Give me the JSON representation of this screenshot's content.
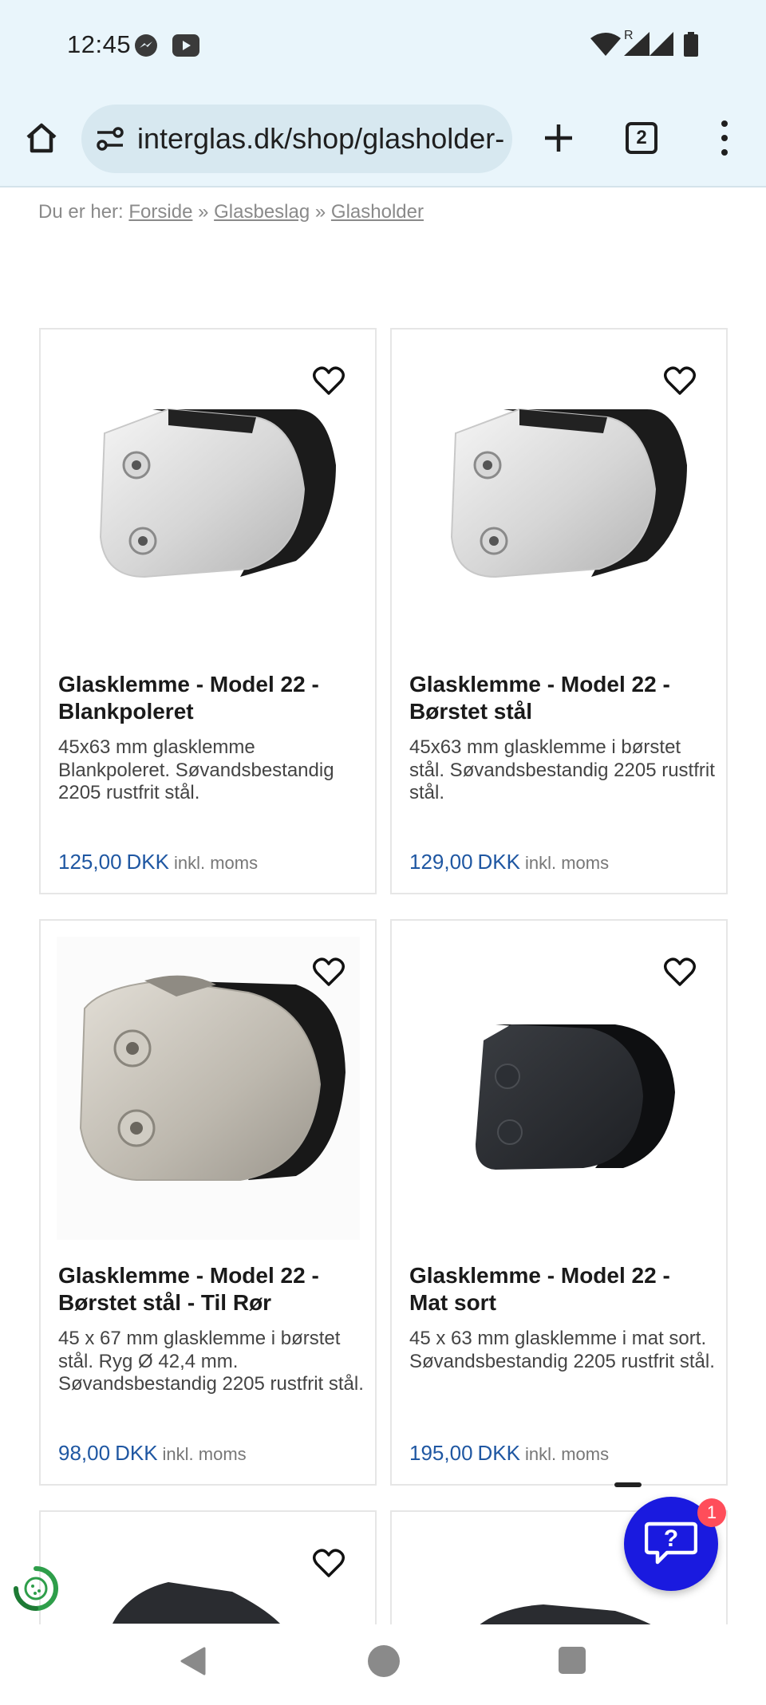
{
  "status_bar": {
    "time": "12:45",
    "icons": [
      "messenger-icon",
      "youtube-icon",
      "wifi-icon",
      "signal-icon",
      "signal-icon",
      "battery-icon"
    ],
    "roaming_label": "R"
  },
  "browser": {
    "url": "interglas.dk/shop/glasholder-",
    "tab_count": "2",
    "icons": [
      "home-icon",
      "site-settings-icon",
      "plus-icon",
      "tab-switcher-icon",
      "menu-icon"
    ]
  },
  "breadcrumb": {
    "prefix": "Du er her:",
    "items": [
      "Forside",
      "Glasbeslag",
      "Glasholder"
    ],
    "separator": "»"
  },
  "products": [
    {
      "title": "Glasklemme - Model 22 - Blankpoleret",
      "description": "45x63 mm glasklemme Blankpoleret. Søvandsbestandig 2205 rustfrit stål.",
      "price": "125,00",
      "currency": "DKK",
      "vat_note": "inkl. moms",
      "finish": "polished"
    },
    {
      "title": "Glasklemme - Model 22 - Børstet stål",
      "description": "45x63 mm glasklemme i børstet stål. Søvandsbestandig 2205 rustfrit stål.",
      "price": "129,00",
      "currency": "DKK",
      "vat_note": "inkl. moms",
      "finish": "polished"
    },
    {
      "title": "Glasklemme - Model 22 - Børstet stål - Til Rør",
      "description": "45 x 67 mm glasklemme i børstet stål. Ryg Ø 42,4 mm. Søvandsbestandig 2205 rustfrit stål.",
      "price": "98,00",
      "currency": "DKK",
      "vat_note": "inkl. moms",
      "finish": "brushed"
    },
    {
      "title": "Glasklemme - Model 22 - Mat sort",
      "description": "45 x 63 mm glasklemme i mat sort. Søvandsbestandig 2205 rustfrit stål.",
      "price": "195,00",
      "currency": "DKK",
      "vat_note": "inkl. moms",
      "finish": "black"
    }
  ],
  "help_widget": {
    "badge_count": "1",
    "icon": "help-chat-icon"
  },
  "colors": {
    "price": "#1f57a2",
    "help_button": "#1a1adf",
    "badge": "#ff4d5a",
    "browser_chrome": "#e9f5fb"
  },
  "nav_bar": {
    "icons": [
      "back-icon",
      "home-circle-icon",
      "recents-icon"
    ]
  }
}
